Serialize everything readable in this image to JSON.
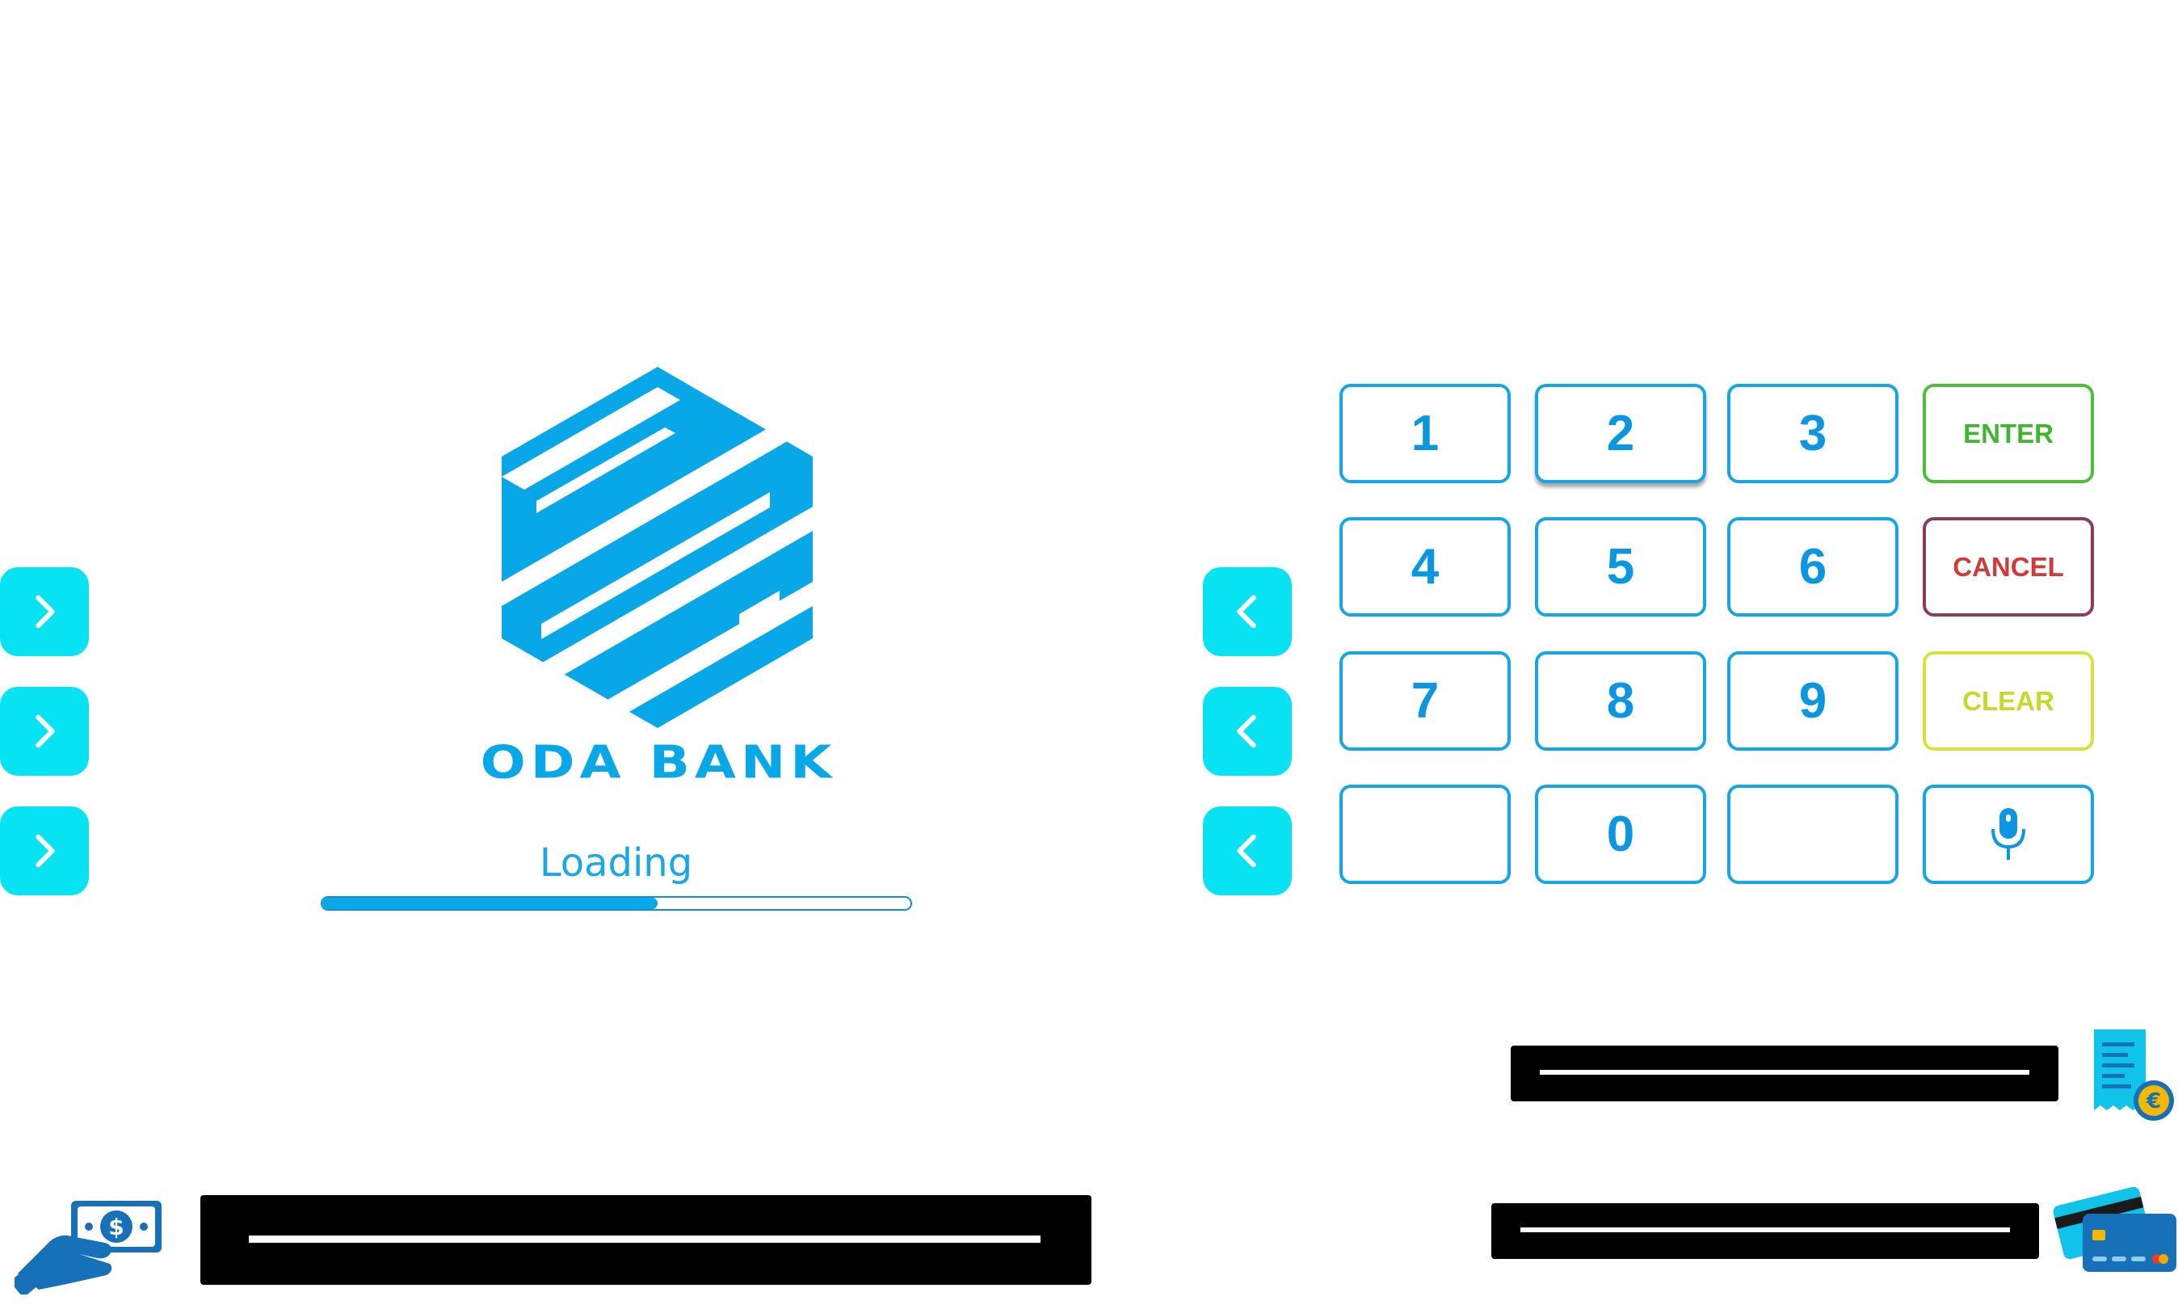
{
  "brand": {
    "name": "ODA BANK",
    "color": "#08a8e8"
  },
  "loading": {
    "label": "Loading",
    "progress": 0.57
  },
  "left_buttons": [
    {
      "icon": "chevron-right-icon"
    },
    {
      "icon": "chevron-right-icon"
    },
    {
      "icon": "chevron-right-icon"
    }
  ],
  "right_buttons": [
    {
      "icon": "chevron-left-icon"
    },
    {
      "icon": "chevron-left-icon"
    },
    {
      "icon": "chevron-left-icon"
    }
  ],
  "keypad": {
    "keys": [
      "1",
      "2",
      "3",
      "ENTER",
      "4",
      "5",
      "6",
      "CANCEL",
      "7",
      "8",
      "9",
      "CLEAR",
      "",
      "0",
      "",
      ""
    ],
    "mic_icon": "microphone-icon",
    "colors": {
      "digit": "#0a96e0",
      "enter": "#41b52f",
      "cancel": "#d23a3a",
      "clear": "#c6d82c"
    }
  },
  "slots": {
    "receipt_icon": "receipt-euro-icon",
    "card_icon": "credit-card-icon",
    "cash_icon": "cash-dispense-icon"
  },
  "accent": "#08e3f3"
}
